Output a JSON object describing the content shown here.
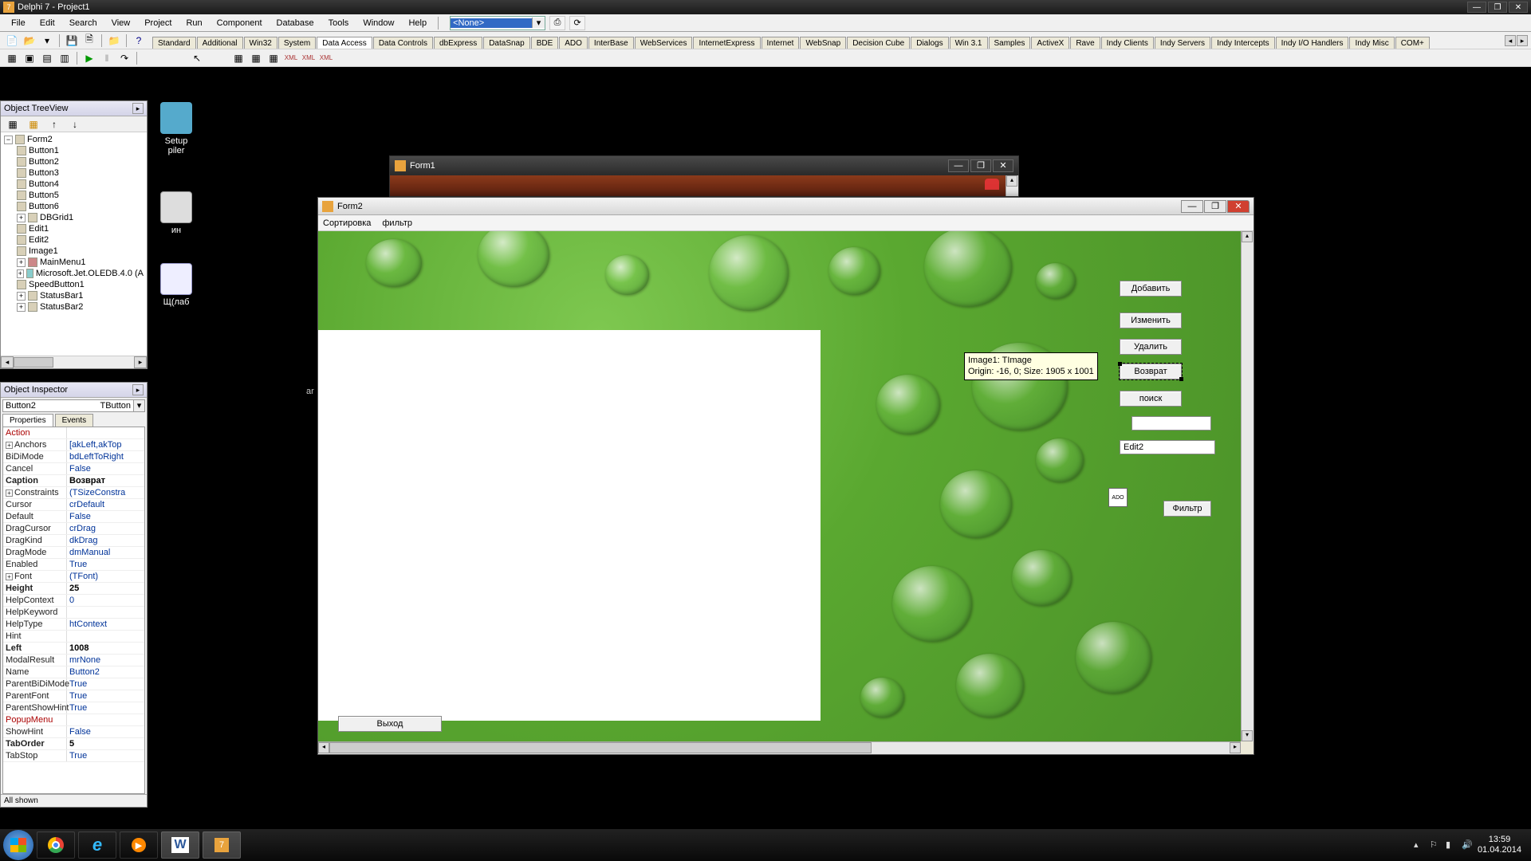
{
  "titlebar": {
    "title": "Delphi 7 - Project1"
  },
  "menu": [
    "File",
    "Edit",
    "Search",
    "View",
    "Project",
    "Run",
    "Component",
    "Database",
    "Tools",
    "Window",
    "Help"
  ],
  "combo_value": "<None>",
  "palette_tabs": [
    "Standard",
    "Additional",
    "Win32",
    "System",
    "Data Access",
    "Data Controls",
    "dbExpress",
    "DataSnap",
    "BDE",
    "ADO",
    "InterBase",
    "WebServices",
    "InternetExpress",
    "Internet",
    "WebSnap",
    "Decision Cube",
    "Dialogs",
    "Win 3.1",
    "Samples",
    "ActiveX",
    "Rave",
    "Indy Clients",
    "Indy Servers",
    "Indy Intercepts",
    "Indy I/O Handlers",
    "Indy Misc",
    "COM+"
  ],
  "palette_active": 4,
  "treeview": {
    "title": "Object TreeView",
    "root": "Form2",
    "nodes": [
      "Button1",
      "Button2",
      "Button3",
      "Button4",
      "Button5",
      "Button6",
      "DBGrid1",
      "Edit1",
      "Edit2",
      "Image1",
      "MainMenu1",
      "Microsoft.Jet.OLEDB.4.0 (A",
      "SpeedButton1",
      "StatusBar1",
      "StatusBar2"
    ]
  },
  "inspector": {
    "title": "Object Inspector",
    "component_name": "Button2",
    "component_type": "TButton",
    "tabs": [
      "Properties",
      "Events"
    ],
    "props": [
      {
        "k": "Action",
        "v": "",
        "red": true
      },
      {
        "k": "Anchors",
        "v": "[akLeft,akTop",
        "exp": true
      },
      {
        "k": "BiDiMode",
        "v": "bdLeftToRight"
      },
      {
        "k": "Cancel",
        "v": "False"
      },
      {
        "k": "Caption",
        "v": "Возврат",
        "bold": true
      },
      {
        "k": "Constraints",
        "v": "(TSizeConstra",
        "exp": true
      },
      {
        "k": "Cursor",
        "v": "crDefault"
      },
      {
        "k": "Default",
        "v": "False"
      },
      {
        "k": "DragCursor",
        "v": "crDrag"
      },
      {
        "k": "DragKind",
        "v": "dkDrag"
      },
      {
        "k": "DragMode",
        "v": "dmManual"
      },
      {
        "k": "Enabled",
        "v": "True"
      },
      {
        "k": "Font",
        "v": "(TFont)",
        "exp": true
      },
      {
        "k": "Height",
        "v": "25",
        "bold": true
      },
      {
        "k": "HelpContext",
        "v": "0"
      },
      {
        "k": "HelpKeyword",
        "v": ""
      },
      {
        "k": "HelpType",
        "v": "htContext"
      },
      {
        "k": "Hint",
        "v": ""
      },
      {
        "k": "Left",
        "v": "1008",
        "bold": true
      },
      {
        "k": "ModalResult",
        "v": "mrNone"
      },
      {
        "k": "Name",
        "v": "Button2"
      },
      {
        "k": "ParentBiDiMode",
        "v": "True"
      },
      {
        "k": "ParentFont",
        "v": "True"
      },
      {
        "k": "ParentShowHint",
        "v": "True"
      },
      {
        "k": "PopupMenu",
        "v": "",
        "red": true
      },
      {
        "k": "ShowHint",
        "v": "False"
      },
      {
        "k": "TabOrder",
        "v": "5",
        "bold": true
      },
      {
        "k": "TabStop",
        "v": "True"
      }
    ],
    "status": "All shown"
  },
  "form1": {
    "title": "Form1"
  },
  "form2": {
    "title": "Form2",
    "menu": [
      "Сортировка",
      "фильтр"
    ],
    "buttons": {
      "add": "Добавить",
      "edit": "Изменить",
      "delete": "Удалить",
      "return": "Возврат",
      "search": "поиск",
      "filter": "Фильтр",
      "exit": "Выход"
    },
    "edit2": "Edit2",
    "tooltip_line1": "Image1: TImage",
    "tooltip_line2": "Origin: -16, 0; Size: 1905 x 1001"
  },
  "desktop": {
    "setup": "Setup",
    "piler": "piler",
    "in": "ин",
    "lab": "Щ(лаб"
  },
  "ar_label": "ar",
  "taskbar": {
    "time": "13:59",
    "date": "01.04.2014"
  }
}
